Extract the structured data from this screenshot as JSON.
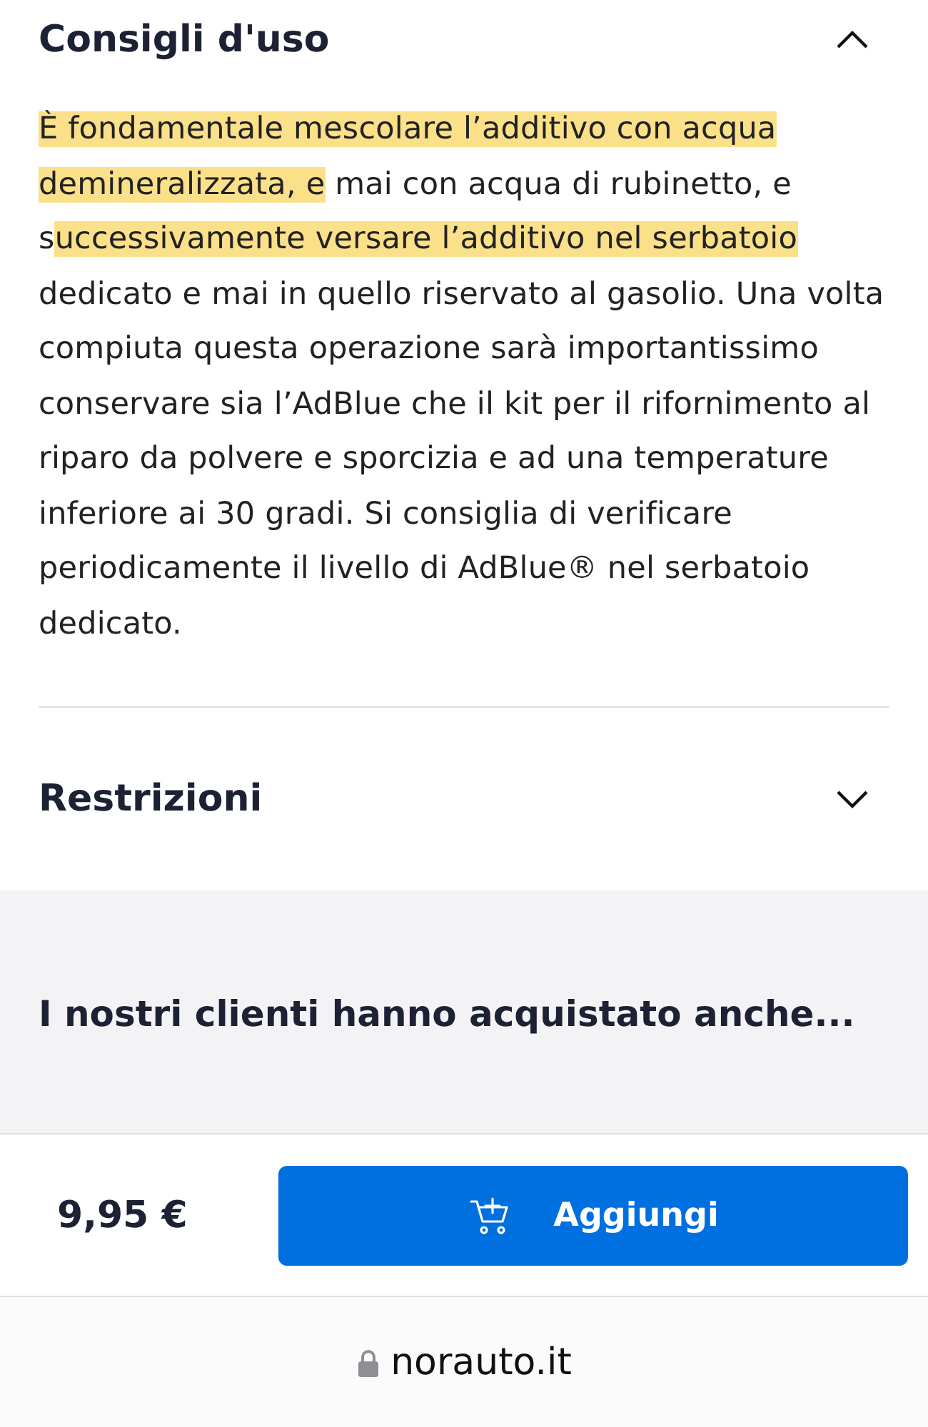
{
  "sections": [
    {
      "title": "Consigli d'uso",
      "expanded": true,
      "body": [
        {
          "text": "È fondamentale mescolare l’additivo con acqua demineralizzata, e",
          "highlighted": true
        },
        {
          "text": " mai con acqua di rubinetto, e s",
          "highlighted": false
        },
        {
          "text": "uccessivamente versare l’additivo nel serbatoio",
          "highlighted": true
        },
        {
          "text": " dedicato e mai in quello riservato al gasolio. Una volta compiuta questa operazione sarà importantissimo conservare sia l’AdBlue che il kit per il rifornimento al riparo da polvere e sporcizia e ad una temperature inferiore ai 30 gradi. Si consiglia di verificare periodicamente il livello di AdBlue® nel serbatoio dedicato.",
          "highlighted": false
        }
      ]
    },
    {
      "title": "Restrizioni",
      "expanded": false
    }
  ],
  "related": {
    "title": "I nostri clienti hanno acquistato anche..."
  },
  "buy_bar": {
    "price": "9,95 €",
    "button": "Aggiungi"
  },
  "browser": {
    "address": "norauto.it"
  }
}
